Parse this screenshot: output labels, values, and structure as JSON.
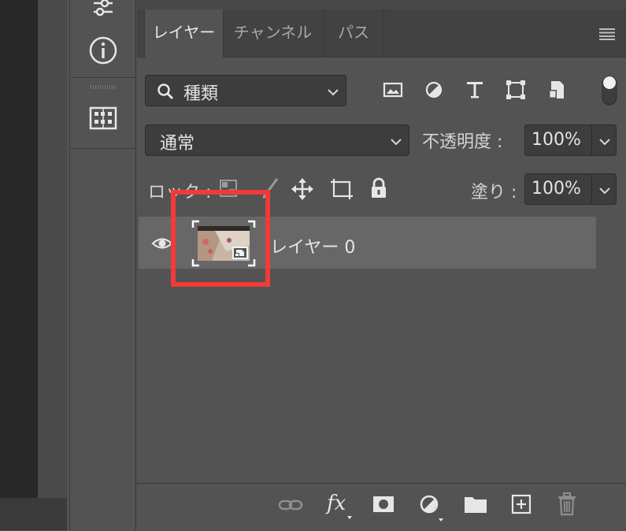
{
  "tabs": [
    {
      "label": "レイヤー",
      "active": true
    },
    {
      "label": "チャンネル",
      "active": false
    },
    {
      "label": "パス",
      "active": false
    }
  ],
  "filter": {
    "value": "種類"
  },
  "blend": {
    "mode": "通常",
    "opacity_label": "不透明度 :",
    "opacity_value": "100%"
  },
  "lock": {
    "label": "ロック :",
    "fill_label": "塗り :",
    "fill_value": "100%"
  },
  "layers": [
    {
      "name": "レイヤー 0",
      "visible": true,
      "smart_object": true,
      "selected": true
    }
  ],
  "bottom_toolbar": {
    "fx_label": "fx"
  },
  "filter_icons": [
    "image-icon",
    "adjustment-icon",
    "type-icon",
    "shape-icon",
    "smart-object-icon"
  ],
  "lock_icons": [
    "lock-pixels-icon",
    "lock-brush-icon",
    "lock-move-icon",
    "lock-artboard-icon",
    "lock-all-icon"
  ],
  "bottom_icons": [
    "link-icon",
    "fx-icon",
    "mask-icon",
    "adjustment-layer-icon",
    "group-folder-icon",
    "new-layer-icon",
    "trash-icon"
  ],
  "colors": {
    "highlight": "#f23a3a",
    "panel_bg": "#535353",
    "selected_row": "#676767"
  }
}
